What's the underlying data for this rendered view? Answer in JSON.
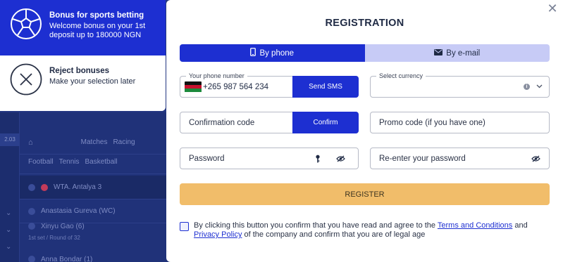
{
  "background": {
    "left_number": "2.03",
    "nav_tabs": [
      "Matches",
      "Racing"
    ],
    "sport_tabs": [
      "Football",
      "Tennis",
      "Basketball"
    ],
    "league": "WTA. Antalya 3",
    "players": [
      "Anastasia Gureva (WC)",
      "Xinyu Gao (6)",
      "Anna Bondar (1)"
    ],
    "round": "1st set / Round of 32"
  },
  "bonus": {
    "accept": {
      "icon": "soccer-ball-icon",
      "title": "Bonus for sports betting",
      "description": "Welcome bonus on your 1st deposit up to 180000 NGN"
    },
    "reject": {
      "icon": "x-circle-icon",
      "title": "Reject bonuses",
      "description": "Make your selection later"
    }
  },
  "modal": {
    "title": "REGISTRATION",
    "tabs": [
      {
        "label": "By phone",
        "icon": "phone-icon",
        "active": true
      },
      {
        "label": "By e-mail",
        "icon": "envelope-icon",
        "active": false
      }
    ],
    "phone": {
      "label": "Your phone number",
      "value": "+265 987 564 234",
      "flag": "malawi-flag-icon",
      "send_label": "Send SMS"
    },
    "currency": {
      "label": "Select currency",
      "value": ""
    },
    "confirmation": {
      "placeholder": "Confirmation code",
      "button_label": "Confirm"
    },
    "promo": {
      "placeholder": "Promo code (if you have one)"
    },
    "password": {
      "placeholder": "Password"
    },
    "repassword": {
      "placeholder": "Re-enter your password"
    },
    "register_label": "REGISTER",
    "consent": {
      "text_before": "By clicking this button you confirm that you have read and agree to the ",
      "terms_link": "Terms and Conditions",
      "text_and": " and ",
      "privacy_link": "Privacy Policy",
      "text_after": " of the company and confirm that you are of legal age"
    }
  },
  "colors": {
    "primary": "#1d2fd1",
    "tab_inactive": "#c7cbf6",
    "register": "#f1bd6a"
  }
}
